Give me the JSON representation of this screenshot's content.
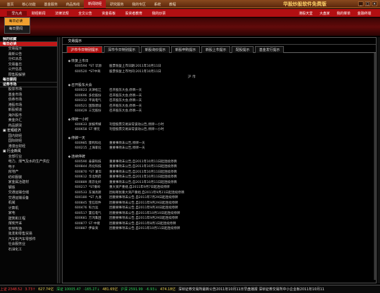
{
  "topnav": [
    "首页",
    "核心功能",
    "基金服务",
    "商品热线",
    "新闻财经",
    "研究服务",
    "我的专区",
    "系统",
    "教程"
  ],
  "brand": "华股炒股软件免费版",
  "subnav": [
    "早九点",
    "财经新闻",
    "法律法规",
    "全文公告",
    "资金看板",
    "投资者教育",
    "我的炒票"
  ],
  "subright": [
    "港股天堂",
    "大盘家",
    "我的菜单",
    "金融终端"
  ],
  "dropdown": [
    "每日必读",
    "每日要闻"
  ],
  "sidebar": [
    {
      "k": "head",
      "t": "我的收藏"
    },
    {
      "k": "headred",
      "t": "每日必读"
    },
    {
      "k": "item",
      "t": "交易提示"
    },
    {
      "k": "item",
      "t": "最新公告"
    },
    {
      "k": "item",
      "t": "分红派息"
    },
    {
      "k": "item",
      "t": "交易备忘"
    },
    {
      "k": "item",
      "t": "公开信息"
    },
    {
      "k": "item",
      "t": "限售股解禁"
    },
    {
      "k": "head",
      "t": "每日要闻"
    },
    {
      "k": "head",
      "t": "证券市场"
    },
    {
      "k": "item",
      "t": "股票市场"
    },
    {
      "k": "item",
      "t": "基金市场"
    },
    {
      "k": "item",
      "t": "债券市场"
    },
    {
      "k": "item",
      "t": "港股市场"
    },
    {
      "k": "item",
      "t": "新股频道"
    },
    {
      "k": "item",
      "t": "海外股市"
    },
    {
      "k": "item",
      "t": "黄金外汇"
    },
    {
      "k": "item",
      "t": "商品期货"
    },
    {
      "k": "group",
      "t": "▣ 宏观经济"
    },
    {
      "k": "item",
      "t": "国内财经"
    },
    {
      "k": "item",
      "t": "国际财经"
    },
    {
      "k": "item",
      "t": "港澳台财经"
    },
    {
      "k": "group",
      "t": "▣ 行业新闻"
    },
    {
      "k": "item",
      "t": "全部行业"
    },
    {
      "k": "item",
      "t": "电力、煤气及水的生产供应"
    },
    {
      "k": "item",
      "t": "电子"
    },
    {
      "k": "item",
      "t": "房地产"
    },
    {
      "k": "item",
      "t": "纺织服装"
    },
    {
      "k": "item",
      "t": "家金属冶建材"
    },
    {
      "k": "item",
      "t": "钢铁"
    },
    {
      "k": "item",
      "t": "交通运输仓储"
    },
    {
      "k": "item",
      "t": "交通运输设备"
    },
    {
      "k": "item",
      "t": "机械"
    },
    {
      "k": "item",
      "t": "计算机"
    },
    {
      "k": "item",
      "t": "家电"
    },
    {
      "k": "item",
      "t": "建筑和工程"
    },
    {
      "k": "item",
      "t": "煤炭开采"
    },
    {
      "k": "item",
      "t": "农林牧渔"
    },
    {
      "k": "item",
      "t": "批发和零售贸易"
    },
    {
      "k": "item",
      "t": "汽车和汽车零部件"
    },
    {
      "k": "item",
      "t": "社会服务业"
    },
    {
      "k": "item",
      "t": "石油化工"
    }
  ],
  "main_title": "交易提示",
  "tabs": [
    "沪市今日特别提示",
    "深市今日特别提示",
    "新股询价提示",
    "新股申购提示",
    "新股上市提示",
    "配股提示",
    "基金发行提示"
  ],
  "sections": [
    {
      "title": "恢复上市日",
      "rows": [
        [
          "600594",
          "*ST 华源",
          "股票恢复上市日期:2011年10月11日"
        ],
        [
          "600520",
          "*ST中商",
          "股票恢复上市时间:2011年10月11日"
        ]
      ],
      "mid": "沪 市"
    },
    {
      "title": "召开股东大会",
      "rows": [
        [
          "600023",
          "天津松江",
          "召开股东大会,停牌一天"
        ],
        [
          "600696",
          "多伦股份",
          "召开股东大会,停牌一天"
        ],
        [
          "600312",
          "平高电气",
          "召开股东大会,停牌一天"
        ],
        [
          "600521",
          "国旅建设",
          "召开股东大会,停牌一天"
        ],
        [
          "600429",
          "三元股份",
          "召开股东大会,停牌一天"
        ]
      ]
    },
    {
      "title": "停牌一小时",
      "rows": [
        [
          "600633",
          "浙报传媒",
          "刊登股票交易异常波动公告,停牌一小时"
        ],
        [
          "600658",
          "ST 博元",
          "刊登股票交易异常波动公告,停牌一小时"
        ]
      ]
    },
    {
      "title": "停牌一天",
      "rows": [
        [
          "600985",
          "雷鸣科化",
          "重要事项未公告,停牌一天"
        ],
        [
          "600215",
          "上海家化",
          "重要事项未公告,停牌一天"
        ]
      ]
    },
    {
      "title": "连续停牌",
      "rows": [
        [
          "600590",
          "泰豪科技",
          "重要事项未公告,自2011年10月11日起连续停牌"
        ],
        [
          "600844",
          "丹化科技",
          "重要事项未公告,自2011年10月11日起连续停牌"
        ],
        [
          "600870",
          "*ST 厦华",
          "重要事项未公告,自2011年10月11日起连续停牌"
        ],
        [
          "600612",
          "华北制药",
          "重要事项未公告,自2011年10月11日起连续停牌"
        ],
        [
          "600889",
          "南京化纤",
          "重要事项未公告,自2011年10月11日起连续停牌"
        ],
        [
          "600217",
          "*ST秦岭",
          "重大资产重组,自2011年9月7日起连续停牌"
        ],
        [
          "600533",
          "东湖高新",
          "因拟筹划重大资产重组,自2011年9月21日起连续停牌"
        ],
        [
          "600180",
          "*ST 九发",
          "因重要事项未公告,自2011年7月29日起连续停牌"
        ],
        [
          "600845",
          "宝信软件",
          "因重要事项未公告,自2011年9月29日起连续停牌"
        ],
        [
          "600476",
          "科力远",
          "因重要事项未公告,自2011年9月30日起连续停牌"
        ],
        [
          "600517",
          "置信电气",
          "因重要事项未公告,自2011年10月10日起连续停牌"
        ],
        [
          "600681",
          "万鸿集团",
          "因重要事项未公告,自2011年9月29日起连续停牌"
        ],
        [
          "600877",
          "ST 中储",
          "因重要事项未公告,自2011年8月1日起连续停牌"
        ],
        [
          "600887",
          "伊泰资",
          "因重要事项未公告,自2011年10月11日起连续停牌"
        ]
      ]
    }
  ],
  "status": [
    {
      "t": "上证 2348.52",
      "c": "r"
    },
    {
      "t": "3.73↑",
      "c": "r"
    },
    {
      "t": "627.74亿",
      "c": "y"
    },
    {
      "t": "深证 10005.47",
      "c": "g"
    },
    {
      "t": "-165.27↓",
      "c": "g"
    },
    {
      "t": "481.65亿",
      "c": "y"
    },
    {
      "t": "沪深 2591.99",
      "c": "g"
    },
    {
      "t": "-6.93↓",
      "c": "g"
    },
    {
      "t": "474.18亿",
      "c": "y"
    },
    {
      "t": "  深圳证券交易所最新公告2011年10月11日早盘播报  深圳证券交易所中小企业板2011年10月11",
      "c": "w"
    }
  ]
}
